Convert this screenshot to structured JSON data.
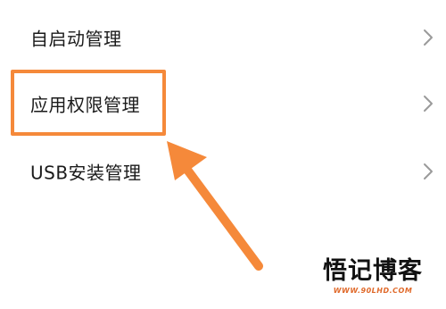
{
  "settings": {
    "items": [
      {
        "label": "自启动管理"
      },
      {
        "label": "应用权限管理"
      },
      {
        "label": "USB安装管理"
      }
    ]
  },
  "annotation": {
    "highlight_color": "#f5893a",
    "arrow_color": "#f5893a"
  },
  "watermark": {
    "title": "悟记博客",
    "url": "WWW.90LHD.COM"
  }
}
